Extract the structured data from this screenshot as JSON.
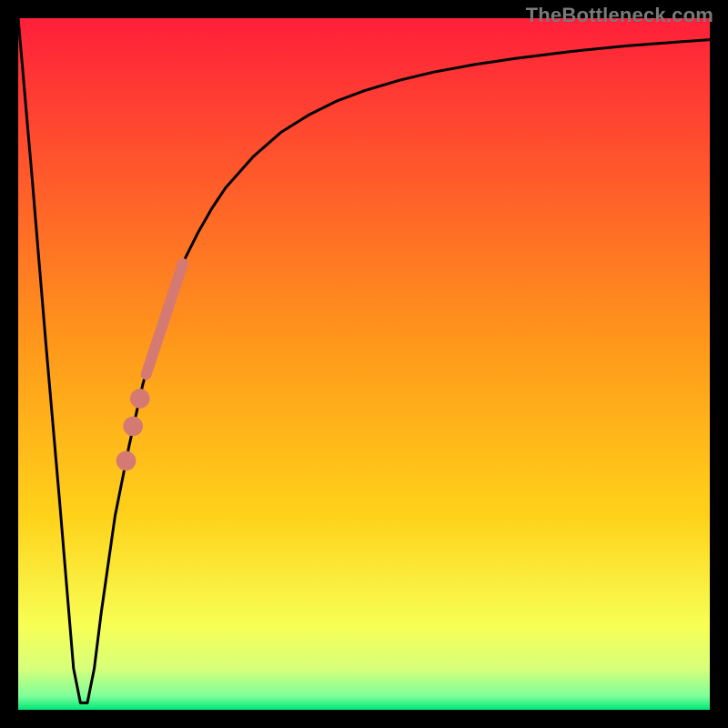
{
  "watermark": "TheBottleneck.com",
  "colors": {
    "frame": "#000000",
    "curve": "#000000",
    "markers": "#d57a72",
    "gradient_top": "#ff1f3a",
    "gradient_mid": "#ffd21a",
    "gradient_low1": "#f7ff55",
    "gradient_low2": "#d8ff7a",
    "gradient_bottom": "#00e676"
  },
  "chart_data": {
    "type": "line",
    "title": "",
    "xlabel": "",
    "ylabel": "",
    "xlim": [
      0,
      100
    ],
    "ylim": [
      0,
      100
    ],
    "annotations": [],
    "series": [
      {
        "name": "bottleneck-curve",
        "x": [
          0,
          2,
          4,
          6,
          7,
          8,
          9,
          10,
          11,
          12,
          14,
          16,
          18,
          20,
          22,
          24,
          26,
          28,
          30,
          34,
          38,
          42,
          46,
          50,
          55,
          60,
          66,
          72,
          80,
          88,
          96,
          100
        ],
        "y": [
          100,
          77,
          53,
          30,
          18,
          6,
          1,
          1,
          6,
          14,
          28,
          38,
          47,
          54,
          60,
          65,
          69,
          72.5,
          75.5,
          80,
          83.5,
          86,
          88,
          89.5,
          91,
          92.2,
          93.3,
          94.2,
          95.2,
          96,
          96.6,
          96.9
        ]
      }
    ],
    "markers": {
      "name": "highlight-segment",
      "style": "thick-line-with-dots",
      "line": {
        "x1": 18.5,
        "y1": 48.5,
        "x2": 23.8,
        "y2": 64.5
      },
      "dots": [
        {
          "x": 17.6,
          "y": 45.0,
          "r": 1.0
        },
        {
          "x": 16.6,
          "y": 41.0,
          "r": 1.0
        },
        {
          "x": 15.6,
          "y": 36.0,
          "r": 1.0
        }
      ]
    }
  }
}
